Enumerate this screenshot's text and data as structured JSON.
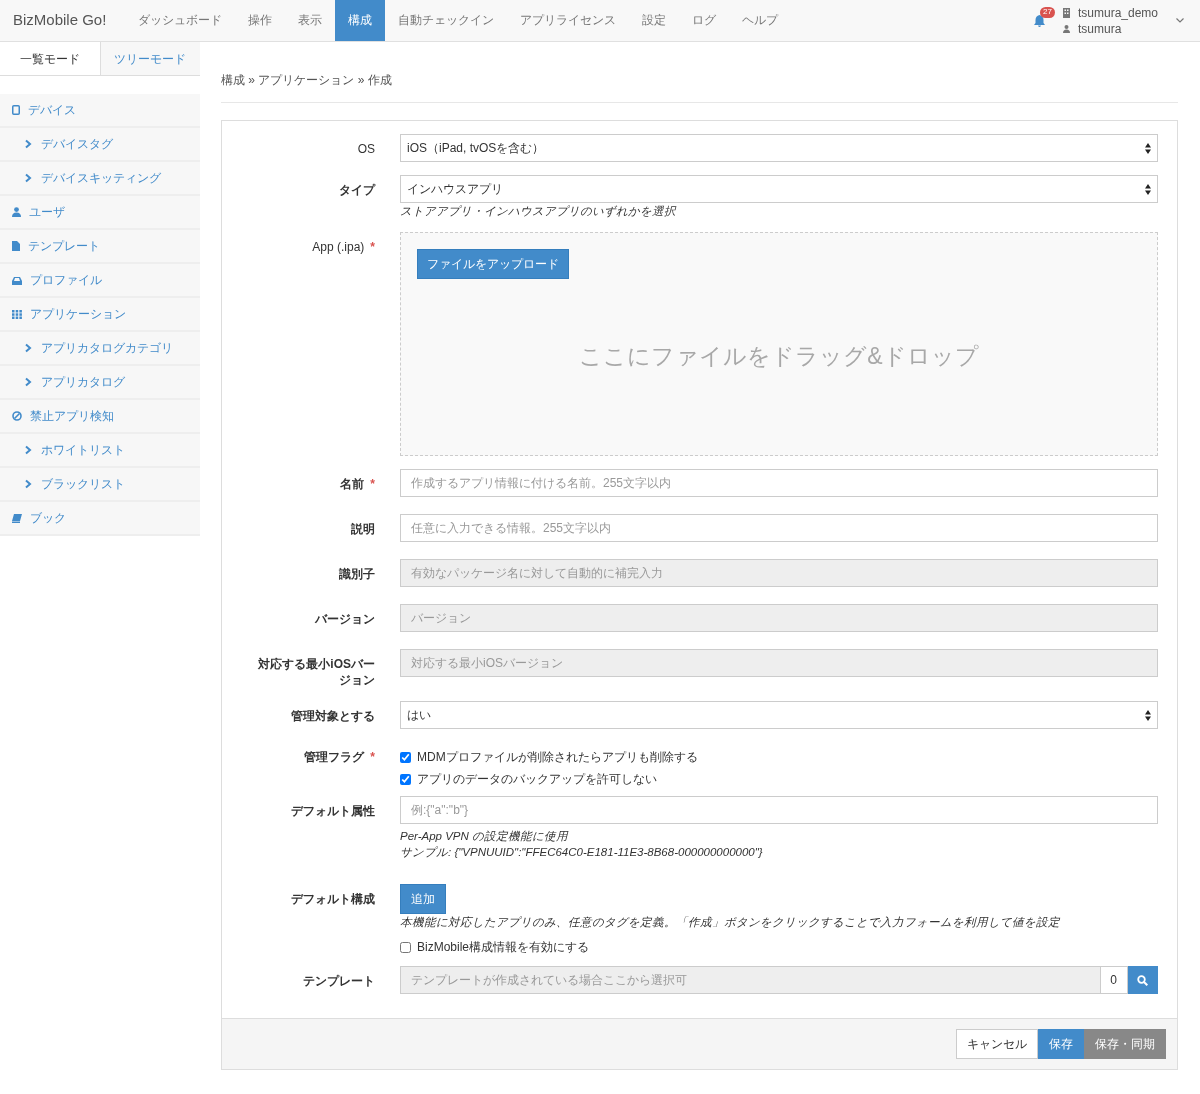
{
  "navbar": {
    "brand": "BizMobile Go!",
    "items": [
      {
        "label": "ダッシュボード",
        "selected": false
      },
      {
        "label": "操作",
        "selected": false
      },
      {
        "label": "表示",
        "selected": false
      },
      {
        "label": "構成",
        "selected": true
      },
      {
        "label": "自動チェックイン",
        "selected": false
      },
      {
        "label": "アプリライセンス",
        "selected": false
      },
      {
        "label": "設定",
        "selected": false
      },
      {
        "label": "ログ",
        "selected": false
      },
      {
        "label": "ヘルプ",
        "selected": false
      }
    ],
    "notification_count": "27",
    "organization": "tsumura_demo",
    "user": "tsumura"
  },
  "sidebar": {
    "tabs": [
      {
        "label": "一覧モード",
        "selected": true
      },
      {
        "label": "ツリーモード",
        "selected": false
      }
    ],
    "items": [
      {
        "label": "デバイス",
        "kind": "device"
      },
      {
        "label": "デバイスタグ",
        "kind": "child"
      },
      {
        "label": "デバイスキッティング",
        "kind": "child"
      },
      {
        "label": "ユーザ",
        "kind": "user"
      },
      {
        "label": "テンプレート",
        "kind": "document"
      },
      {
        "label": "プロファイル",
        "kind": "tray"
      },
      {
        "label": "アプリケーション",
        "kind": "grid"
      },
      {
        "label": "アプリカタログカテゴリ",
        "kind": "child"
      },
      {
        "label": "アプリカタログ",
        "kind": "child"
      },
      {
        "label": "禁止アプリ検知",
        "kind": "ban"
      },
      {
        "label": "ホワイトリスト",
        "kind": "child"
      },
      {
        "label": "ブラックリスト",
        "kind": "child"
      },
      {
        "label": "ブック",
        "kind": "book"
      }
    ]
  },
  "breadcrumb": "構成 » アプリケーション » 作成",
  "form": {
    "fields": [
      {
        "kind": "select",
        "label": "OS",
        "value": "iOS（iPad, tvOSを含む）"
      },
      {
        "kind": "select",
        "label": "タイプ",
        "value": "インハウスアプリ",
        "help": [
          "ストアアプリ・インハウスアプリのいずれかを選択"
        ]
      },
      {
        "kind": "upload",
        "label": "App (.ipa)",
        "required_mark": "*",
        "button": "ファイルをアップロード",
        "drop_text": "ここにファイルをドラッグ&ドロップ"
      },
      {
        "kind": "text",
        "label": "名前",
        "required_mark": "*",
        "placeholder": "作成するアプリ情報に付ける名前。255文字以内",
        "disabled": false
      },
      {
        "kind": "text",
        "label": "説明",
        "placeholder": "任意に入力できる情報。255文字以内",
        "disabled": false
      },
      {
        "kind": "text",
        "label": "識別子",
        "placeholder": "有効なパッケージ名に対して自動的に補完入力",
        "disabled": true
      },
      {
        "kind": "text",
        "label": "バージョン",
        "placeholder": "バージョン",
        "disabled": true
      },
      {
        "kind": "text",
        "label": "対応する最小iOSバージョン",
        "placeholder": "対応する最小iOSバージョン",
        "disabled": true
      },
      {
        "kind": "select",
        "label": "管理対象とする",
        "value": "はい"
      },
      {
        "kind": "checkboxes",
        "label": "管理フラグ",
        "required_mark": "*",
        "options": [
          {
            "label": "MDMプロファイルが削除されたらアプリも削除する",
            "checked": true
          },
          {
            "label": "アプリのデータのバックアップを許可しない",
            "checked": true
          }
        ]
      },
      {
        "kind": "text",
        "label": "デフォルト属性",
        "placeholder": "例:{\"a\":\"b\"}",
        "disabled": false,
        "help": [
          "Per-App VPN の設定機能に使用",
          "サンプル: {\"VPNUUID\":\"FFEC64C0-E181-11E3-8B68-000000000000\"}"
        ]
      },
      {
        "kind": "button",
        "label": "デフォルト構成",
        "button": "追加",
        "help": [
          "本機能に対応したアプリのみ、任意のタグを定義。「作成」ボタンをクリックすることで入力フォームを利用して値を設定"
        ],
        "options": [
          {
            "label": "BizMobile構成情報を有効にする",
            "checked": false
          }
        ]
      },
      {
        "kind": "template",
        "label": "テンプレート",
        "placeholder": "テンプレートが作成されている場合ここから選択可",
        "disabled": true,
        "count": "0"
      }
    ]
  },
  "footer_buttons": [
    {
      "label": "キャンセル",
      "kind": "default"
    },
    {
      "label": "保存",
      "kind": "primary"
    },
    {
      "label": "保存・同期",
      "kind": "secondary"
    }
  ]
}
